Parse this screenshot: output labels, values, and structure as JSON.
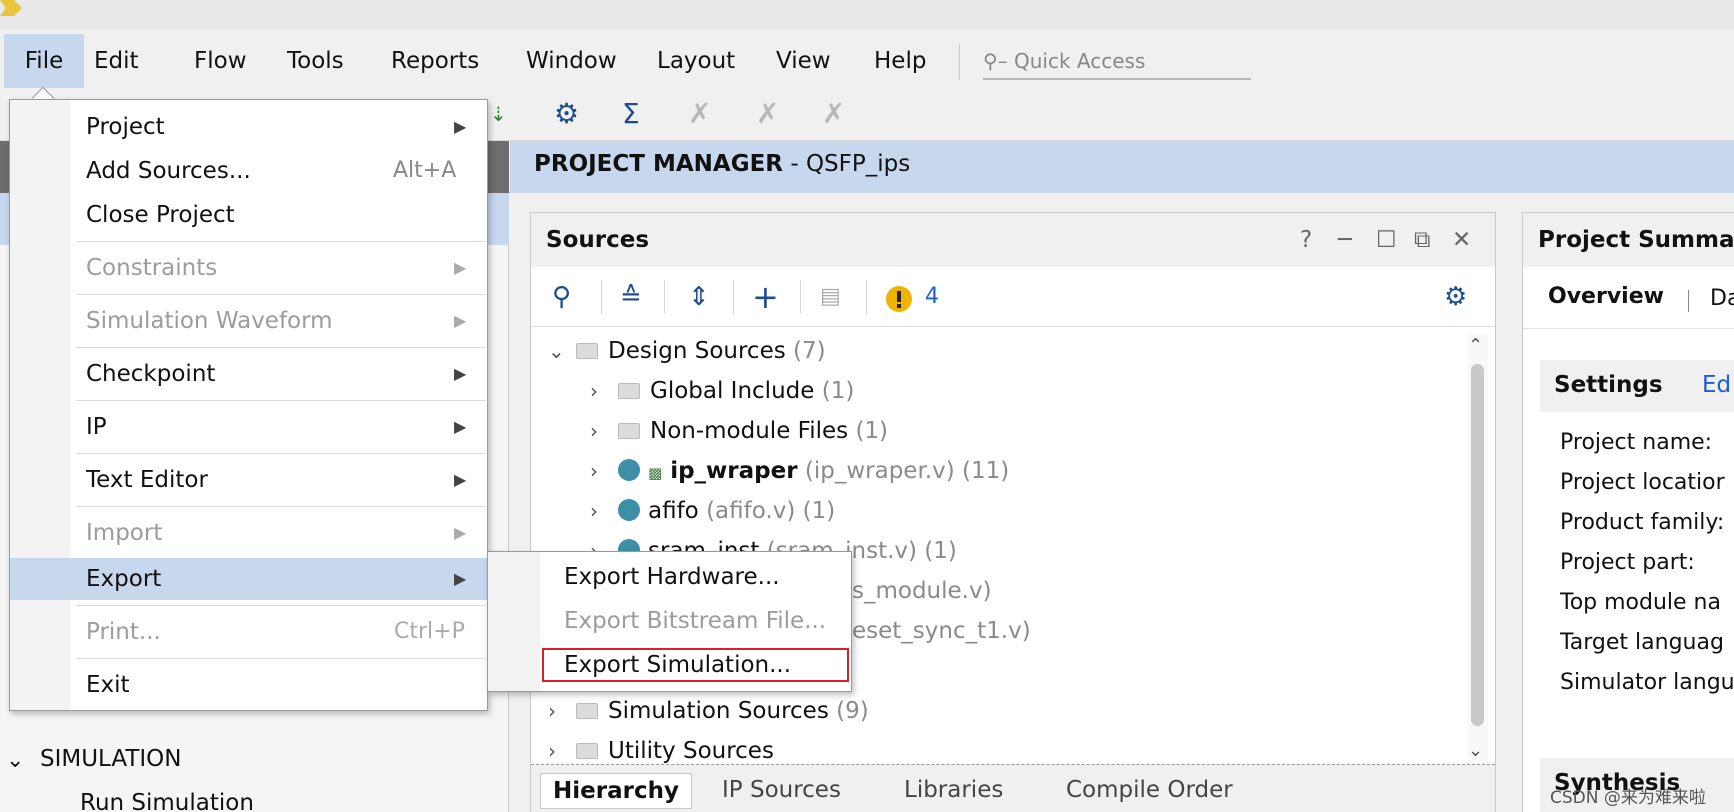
{
  "menubar": {
    "items": [
      "File",
      "Edit",
      "Flow",
      "Tools",
      "Reports",
      "Window",
      "Layout",
      "View",
      "Help"
    ],
    "quick_access_placeholder": "Quick Access"
  },
  "file_menu": {
    "items": [
      {
        "label": "Project",
        "submenu": true,
        "enabled": true
      },
      {
        "label": "Add Sources...",
        "shortcut": "Alt+A",
        "enabled": true
      },
      {
        "label": "Close Project",
        "enabled": true
      },
      {
        "label": "Constraints",
        "submenu": true,
        "enabled": false
      },
      {
        "label": "Simulation Waveform",
        "submenu": true,
        "enabled": false
      },
      {
        "label": "Checkpoint",
        "submenu": true,
        "enabled": true
      },
      {
        "label": "IP",
        "submenu": true,
        "enabled": true
      },
      {
        "label": "Text Editor",
        "submenu": true,
        "enabled": true
      },
      {
        "label": "Import",
        "submenu": true,
        "enabled": false
      },
      {
        "label": "Export",
        "submenu": true,
        "enabled": true,
        "highlighted": true
      },
      {
        "label": "Print...",
        "shortcut": "Ctrl+P",
        "enabled": false
      },
      {
        "label": "Exit",
        "enabled": true
      }
    ]
  },
  "export_submenu": {
    "items": [
      {
        "label": "Export Hardware...",
        "enabled": true
      },
      {
        "label": "Export Bitstream File...",
        "enabled": false
      },
      {
        "label": "Export Simulation...",
        "enabled": true,
        "outlined": true
      }
    ]
  },
  "left_panel": {
    "section": "SIMULATION",
    "item": "Run Simulation"
  },
  "project_manager": {
    "title": "PROJECT MANAGER",
    "project": "QSFP_ips"
  },
  "sources": {
    "title": "Sources",
    "warning_count": "4",
    "tree": [
      {
        "name": "Design Sources",
        "extra": "(7)"
      },
      {
        "name": "Global Include",
        "extra": "(1)"
      },
      {
        "name": "Non-module Files",
        "extra": "(1)"
      },
      {
        "name": "ip_wraper",
        "extra": "(ip_wraper.v) (11)"
      },
      {
        "name": "afifo",
        "extra": "(afifo.v) (1)"
      },
      {
        "name": "sram_inst",
        "extra": "(sram_inst.v) (1)"
      },
      {
        "partial": "s_module.v)"
      },
      {
        "partial": "eset_sync_t1.v)"
      },
      {
        "name": "Simulation Sources",
        "extra": "(9)"
      },
      {
        "name": "Utility Sources",
        "extra": ""
      }
    ],
    "tabs": [
      "Hierarchy",
      "IP Sources",
      "Libraries",
      "Compile Order"
    ]
  },
  "summary": {
    "title": "Project Summa",
    "tab_overview": "Overview",
    "tab_other": "Da",
    "settings": "Settings",
    "edit": "Ed",
    "props": [
      "Project name:",
      "Project locatior",
      "Product family:",
      "Project part:",
      "Top module na",
      "Target languag",
      "Simulator langu"
    ],
    "synthesis": "Synthesis"
  },
  "watermark": "CSDN @来为难来啦",
  "colors": {
    "highlight": "#c7d7ee",
    "outline_red": "#d8202a",
    "icon_blue": "#1e4d8f",
    "link_blue": "#1b5ed1",
    "warning_yellow": "#f0b400",
    "dot_teal": "#3d8fa8"
  }
}
